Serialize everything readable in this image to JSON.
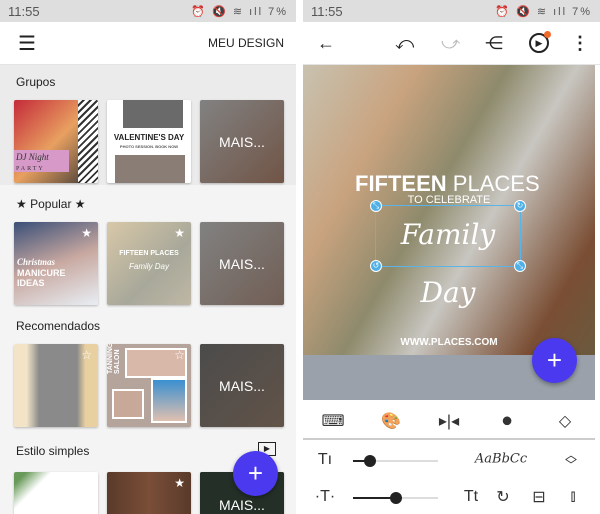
{
  "status": {
    "time": "11:55",
    "battery": "7%"
  },
  "left": {
    "header": {
      "title": "MEU DESIGN"
    },
    "sections": [
      {
        "label": "Grupos",
        "thumbs": [
          {
            "text": "DJ Night",
            "sub": "PARTY"
          },
          {
            "text": "VALENTINE'S DAY",
            "sub": "PHOTO SESSION. BOOK NOW"
          },
          {
            "more": "MAIS..."
          }
        ]
      },
      {
        "label": "★ Popular ★",
        "thumbs": [
          {
            "text": "Christmas",
            "sub": "MANICURE IDEAS"
          },
          {
            "text": "FIFTEEN PLACES",
            "sub": "Family Day"
          },
          {
            "more": "MAIS..."
          }
        ]
      },
      {
        "label": "Recomendados",
        "thumbs": [
          {
            "text": ""
          },
          {
            "text": "TANNING SALON"
          },
          {
            "more": "MAIS..."
          }
        ]
      },
      {
        "label": "Estilo simples",
        "thumbs": [
          {
            "text": ""
          },
          {
            "text": ""
          },
          {
            "more": "MAIS..."
          }
        ]
      }
    ],
    "fab": "+"
  },
  "right": {
    "design": {
      "headline_bold": "FIFTEEN",
      "headline_light": "PLACES",
      "sub": "TO CELEBRATE",
      "script": "Family Day",
      "url": "WWW.PLACES.COM"
    },
    "font_preview": "AaBbCc",
    "fab": "+",
    "sliders": {
      "size": 0.2,
      "spacing": 0.5
    },
    "accent": "#4b39ef"
  }
}
